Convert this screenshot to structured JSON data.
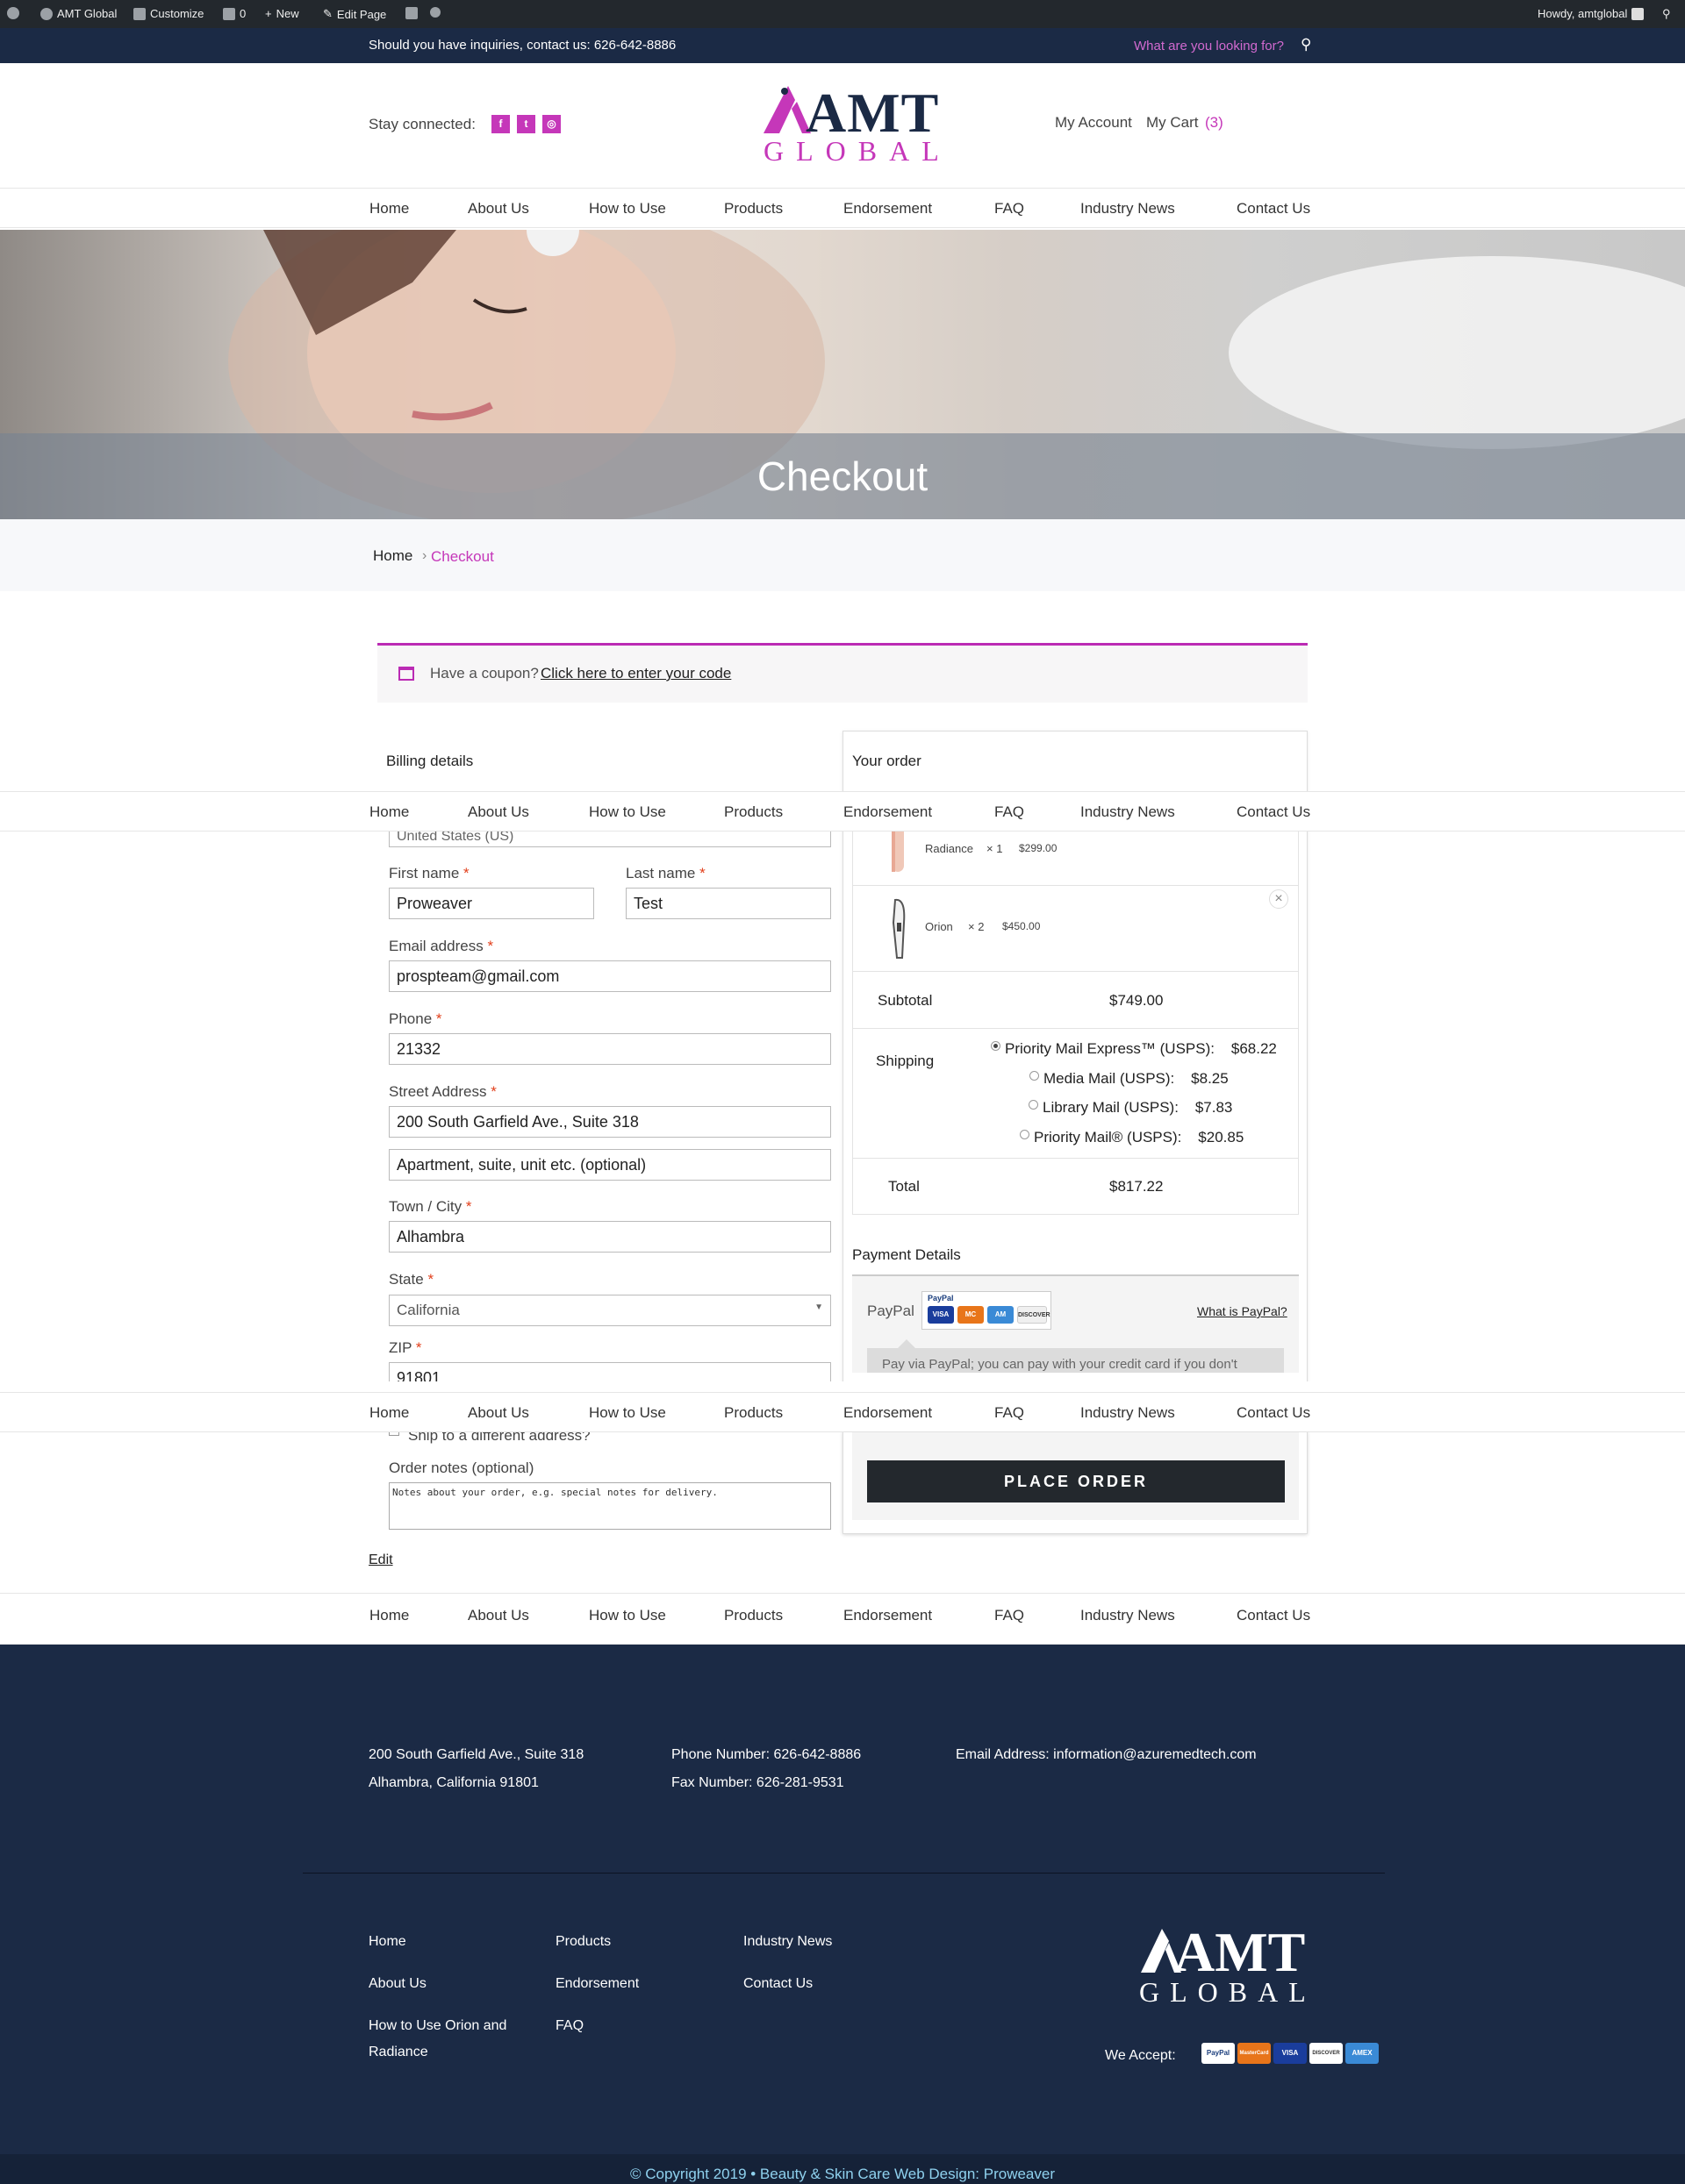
{
  "admin_bar": {
    "site_name": "AMT Global",
    "customize": "Customize",
    "comments_count": "0",
    "new_label": "New",
    "edit_page": "Edit Page",
    "howdy": "Howdy, amtglobal"
  },
  "top_bar": {
    "contact": "Should you have inquiries, contact us: 626-642-8886",
    "search_placeholder": "What are you looking for?"
  },
  "header": {
    "stay_connected": "Stay connected:",
    "logo_top": "AMT",
    "logo_bottom": "GLOBAL",
    "my_account": "My Account",
    "my_cart": "My Cart",
    "cart_count": "(3)"
  },
  "nav": [
    "Home",
    "About Us",
    "How to Use",
    "Products",
    "Endorsement",
    "FAQ",
    "Industry News",
    "Contact Us"
  ],
  "hero": {
    "title": "Checkout"
  },
  "breadcrumb": {
    "home": "Home",
    "sep": "›",
    "current": "Checkout"
  },
  "coupon": {
    "text": "Have a coupon?",
    "link": "Click here to enter your code"
  },
  "billing": {
    "heading": "Billing details",
    "country": "United States (US)",
    "first_name_label": "First name",
    "first_name": "Proweaver",
    "last_name_label": "Last name",
    "last_name": "Test",
    "email_label": "Email address",
    "email": "prospteam@gmail.com",
    "phone_label": "Phone",
    "phone": "21332",
    "street_label": "Street Address",
    "street": "200 South Garfield Ave., Suite 318",
    "apartment_placeholder": "Apartment, suite, unit etc. (optional)",
    "city_label": "Town / City",
    "city": "Alhambra",
    "state_label": "State",
    "state": "California",
    "zip_label": "ZIP",
    "zip": "91801",
    "ship_different": "Ship to a different address?",
    "notes_label": "Order notes (optional)",
    "notes_placeholder": "Notes about your order, e.g. special notes for delivery.",
    "edit": "Edit",
    "required_mark": "*"
  },
  "order": {
    "heading": "Your order",
    "items": [
      {
        "name": "Radiance",
        "qty": "× 1",
        "price": "$299.00"
      },
      {
        "name": "Orion",
        "qty": "× 2",
        "price": "$450.00"
      }
    ],
    "subtotal_label": "Subtotal",
    "subtotal": "$749.00",
    "shipping_label": "Shipping",
    "shipping_options": [
      {
        "label": "Priority Mail Express™ (USPS):",
        "price": "$68.22",
        "selected": true
      },
      {
        "label": "Media Mail (USPS):",
        "price": "$8.25",
        "selected": false
      },
      {
        "label": "Library Mail (USPS):",
        "price": "$7.83",
        "selected": false
      },
      {
        "label": "Priority Mail® (USPS):",
        "price": "$20.85",
        "selected": false
      }
    ],
    "total_label": "Total",
    "total": "$817.22",
    "payment_heading": "Payment Details",
    "paypal_label": "PayPal",
    "what_is_paypal": "What is PayPal?",
    "paypal_note": "Pay via PayPal; you can pay with your credit card if you don't",
    "place_order": "PLACE ORDER",
    "remove_icon": "×"
  },
  "footer": {
    "address1": "200 South Garfield Ave., Suite 318",
    "address2": "Alhambra, California 91801",
    "phone": "Phone Number: 626-642-8886",
    "fax": "Fax Number: 626-281-9531",
    "email": "Email Address: information@azuremedtech.com",
    "links_col1": [
      "Home",
      "About Us",
      "How to Use Orion and",
      "Radiance"
    ],
    "links_col2": [
      "Products",
      "Endorsement",
      "FAQ"
    ],
    "links_col3": [
      "Industry News",
      "Contact Us"
    ],
    "logo_top": "AMT",
    "logo_bottom": "GLOBAL",
    "we_accept": "We Accept:",
    "cards": [
      "PayPal",
      "MasterCard",
      "VISA",
      "DISCOVER",
      "AMEX"
    ],
    "copyright": "© Copyright 2019  •  Beauty & Skin Care Web Design: Proweaver"
  },
  "colors": {
    "accent": "#c537b9",
    "navy": "#1b2a45",
    "button": "#23282d"
  }
}
